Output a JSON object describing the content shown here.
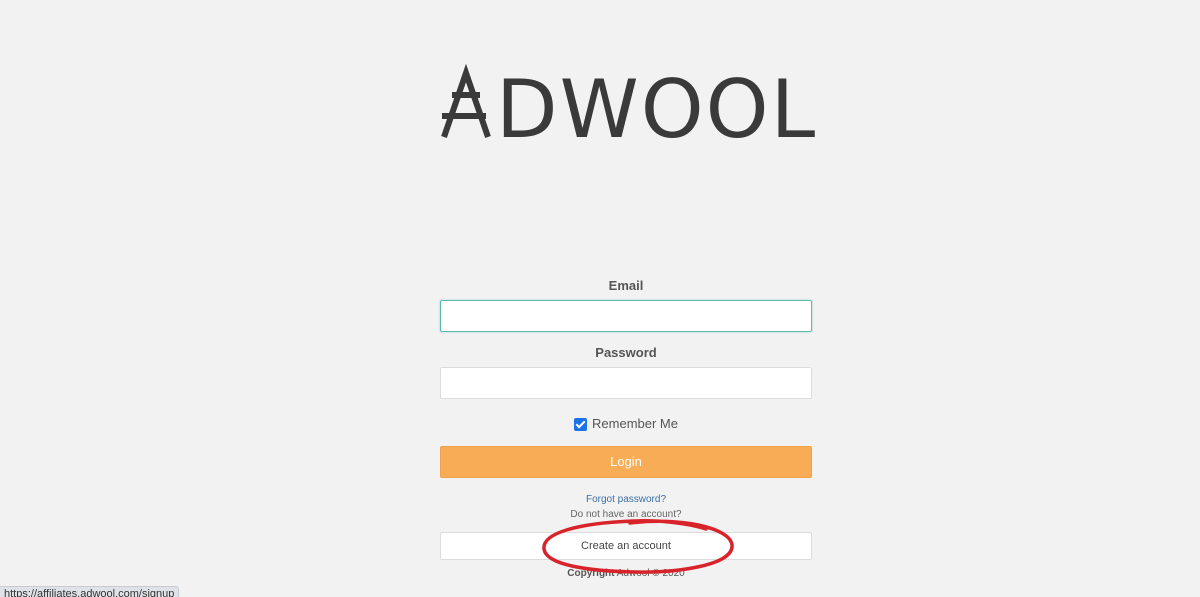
{
  "brand": {
    "name": "ADWOOL",
    "color": "#3a3a3a"
  },
  "form": {
    "email_label": "Email",
    "email_value": "",
    "password_label": "Password",
    "password_value": "",
    "remember_label": "Remember Me",
    "remember_checked": true,
    "login_label": "Login",
    "forgot_label": "Forgot password?",
    "no_account_label": "Do not have an account?",
    "create_label": "Create an account"
  },
  "footer": {
    "copyright_prefix": "Copyright",
    "copyright_rest": "Adwool © 2020"
  },
  "status_bar": {
    "url": "https://affiliates.adwool.com/signup"
  },
  "colors": {
    "background": "#f2f2f2",
    "login_button": "#f7ac55",
    "link": "#3a6fa6",
    "annotation": "#d8232a",
    "checkbox": "#1a73e8"
  }
}
